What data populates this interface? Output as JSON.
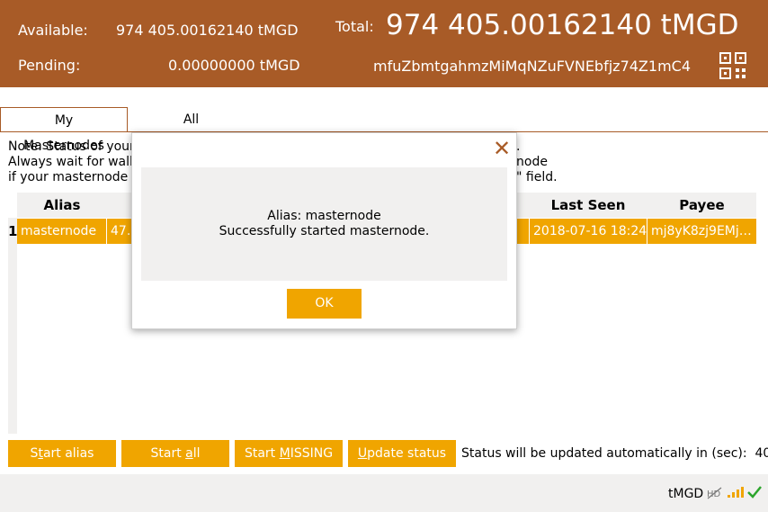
{
  "header": {
    "available_label": "Available:",
    "available_value": "974 405.00162140 tMGD",
    "pending_label": "Pending:",
    "pending_value": "0.00000000 tMGD",
    "total_label": "Total:",
    "total_value": "974 405.00162140 tMGD",
    "address": "mfuZbmtgahmzMiMqNZuFVNEbfjz74Z1mC4"
  },
  "tabs": [
    {
      "label": "My Masternodes",
      "active": true
    },
    {
      "label": "All Masternodes",
      "active": false
    }
  ],
  "note": {
    "line1_start": "Note: Status of your",
    "line1_end": ".",
    "line2_start": "Always wait for walle",
    "line2_end": "node",
    "line3_start": "if your masternode s",
    "line3_end": "\" field."
  },
  "table": {
    "headers": {
      "alias": "Alias",
      "last_seen": "Last Seen",
      "payee": "Payee"
    },
    "rows": [
      {
        "num": "1",
        "alias": "masternode",
        "address": "47.9",
        "status_tail": "",
        "last_seen": "2018-07-16 18:24",
        "payee": "mj8yK8zj9EMj…"
      }
    ]
  },
  "buttons": {
    "start_alias": {
      "pre": "S",
      "ul": "t",
      "post": "art alias"
    },
    "start_all": {
      "pre": "Start ",
      "ul": "a",
      "post": "ll"
    },
    "start_missing": {
      "pre": "Start ",
      "ul": "M",
      "post": "ISSING"
    },
    "update_status": {
      "pre": "",
      "ul": "U",
      "post": "pdate status"
    }
  },
  "auto_update": {
    "label": "Status will be updated automatically in (sec):",
    "seconds": "40"
  },
  "statusbar": {
    "unit": "tMGD",
    "hd_icon": "hd-disabled-icon",
    "network_icon": "signal-bars-icon",
    "sync_icon": "check-icon"
  },
  "dialog": {
    "line1": "Alias: masternode",
    "line2": "Successfully started masternode.",
    "ok": "OK"
  },
  "colors": {
    "brand": "#a85b27",
    "accent": "#f0a500",
    "panel": "#f1f0ef",
    "sync": "#2ca52c"
  }
}
